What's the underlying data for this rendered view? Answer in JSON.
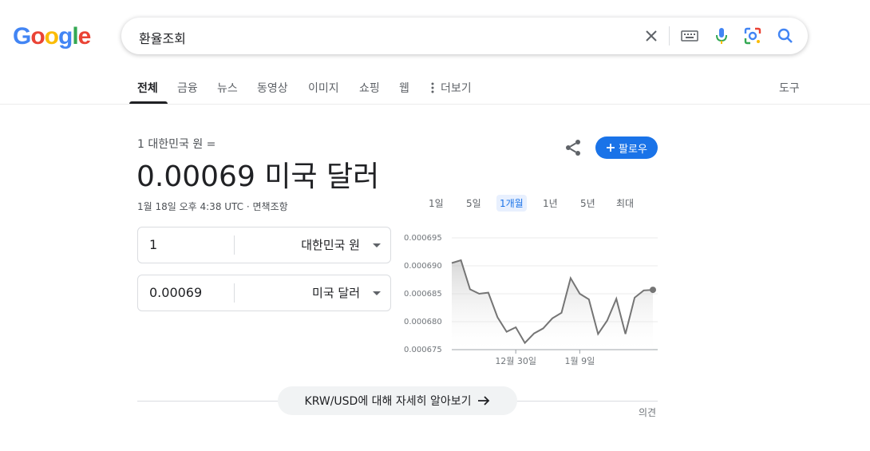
{
  "logo": {
    "letters": [
      "G",
      "o",
      "o",
      "g",
      "l",
      "e"
    ],
    "colors": [
      "#4285F4",
      "#EA4335",
      "#FBBC05",
      "#4285F4",
      "#34A853",
      "#EA4335"
    ]
  },
  "search": {
    "query": "환율조회"
  },
  "tabs": [
    {
      "label": "전체",
      "active": true
    },
    {
      "label": "금융"
    },
    {
      "label": "뉴스"
    },
    {
      "label": "동영상"
    },
    {
      "label": "이미지"
    },
    {
      "label": "쇼핑"
    },
    {
      "label": "웹"
    },
    {
      "label": "더보기"
    }
  ],
  "tools_label": "도구",
  "converter": {
    "from_line": "1 대한민국 원 =",
    "result": "0.00069 미국 달러",
    "timestamp": "1월 18일 오후 4:38 UTC · 면책조항",
    "follow_label": "팔로우",
    "from": {
      "value": "1",
      "currency": "대한민국 원"
    },
    "to": {
      "value": "0.00069",
      "currency": "미국 달러"
    }
  },
  "ranges": [
    {
      "label": "1일"
    },
    {
      "label": "5일"
    },
    {
      "label": "1개월",
      "active": true
    },
    {
      "label": "1년"
    },
    {
      "label": "5년"
    },
    {
      "label": "최대"
    }
  ],
  "chart_data": {
    "type": "line",
    "y_ticks": [
      "0.000695",
      "0.000690",
      "0.000685",
      "0.000680",
      "0.000675"
    ],
    "ylim": [
      0.000675,
      0.000695
    ],
    "x_labels": [
      "12월 30일",
      "1월 9일"
    ],
    "x_label_index": [
      7,
      14
    ],
    "values": [
      0.0006905,
      0.000691,
      0.0006858,
      0.000685,
      0.0006852,
      0.0006808,
      0.0006782,
      0.000679,
      0.0006762,
      0.0006779,
      0.0006788,
      0.0006806,
      0.0006816,
      0.0006878,
      0.000685,
      0.000684,
      0.0006778,
      0.0006802,
      0.0006841,
      0.0006778,
      0.0006843,
      0.0006856,
      0.0006857
    ],
    "line_color": "#757575"
  },
  "more_label": "KRW/USD에 대해 자세히 알아보기",
  "feedback_label": "의견"
}
